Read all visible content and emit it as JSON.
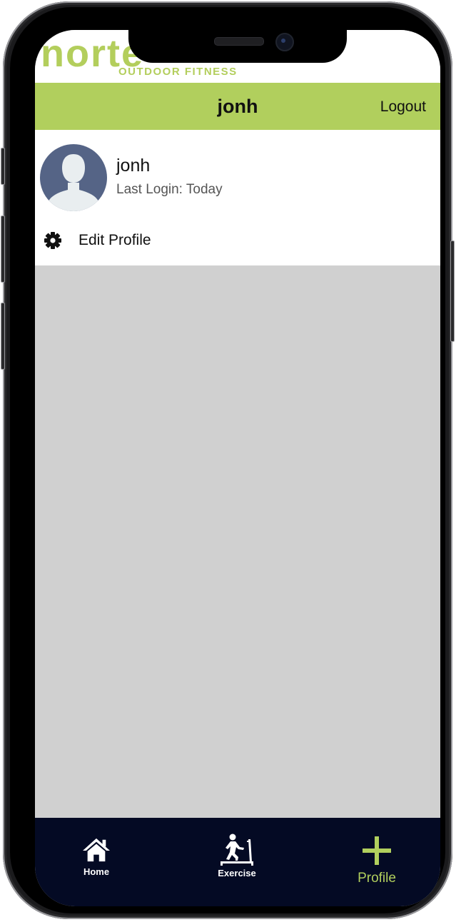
{
  "logo": {
    "wordmark": "norte",
    "tagline": "OUTDOOR FITNESS"
  },
  "header": {
    "title": "jonh",
    "logout_label": "Logout"
  },
  "profile": {
    "name": "jonh",
    "last_login": "Last Login: Today",
    "edit_label": "Edit Profile"
  },
  "nav": {
    "home_label": "Home",
    "exercise_label": "Exercise",
    "profile_label": "Profile",
    "active": "profile"
  },
  "colors": {
    "accent": "#b1cf5d",
    "nav_background": "#040a24",
    "content_background": "#d0d0d0"
  }
}
